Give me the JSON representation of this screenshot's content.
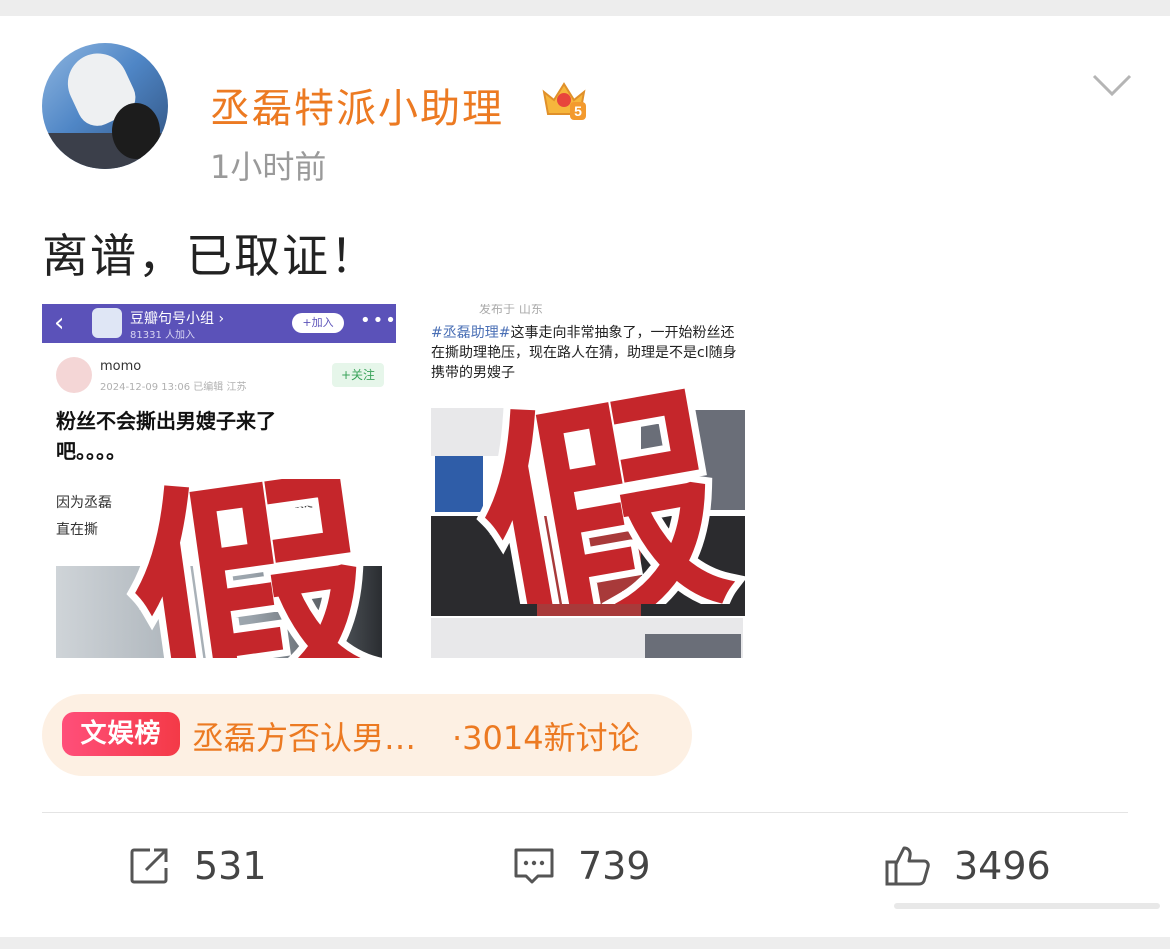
{
  "post": {
    "username": "丞磊特派小助理",
    "time": "1小时前",
    "text": "离谱，已取证！",
    "badge_level": "5"
  },
  "image1": {
    "back": "‹",
    "group_name": "豆瓣句号小组 ›",
    "group_count": "81331 人加入",
    "join_label": "+加入",
    "more": "•••",
    "author": "momo",
    "meta": "2024-12-09 13:06 已编辑 江苏",
    "follow_label": "+关注",
    "title": "粉丝不会撕出男嫂子来了吧。。。。",
    "body_prefix": "因为丞磊",
    "body_mid": "宣切粉最近一",
    "body_line2": "直在撕"
  },
  "image2": {
    "published": "发布于 山东",
    "hashtag": "#丞磊助理#",
    "text": "这事走向非常抽象了，一开始粉丝还在撕助理艳压，现在路人在猜，助理是不是cl随身携带的男嫂子"
  },
  "stamp": {
    "char": "假"
  },
  "trending": {
    "badge": "文娱榜",
    "topic": "丞磊方否认男…",
    "count": "·3014新讨论"
  },
  "actions": {
    "share_count": "531",
    "comment_count": "739",
    "like_count": "3496"
  }
}
